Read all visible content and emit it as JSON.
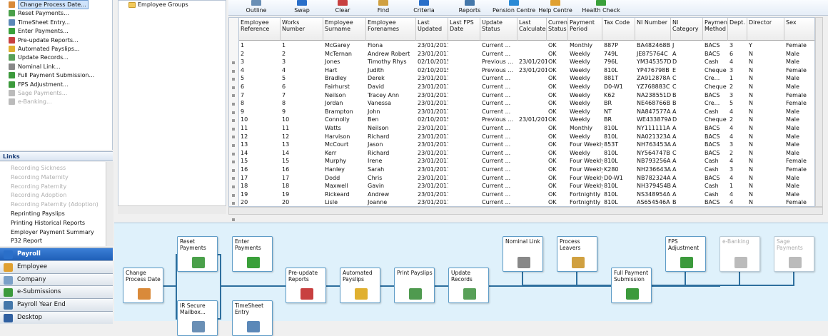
{
  "tasks": [
    {
      "label": "Change Process Date...",
      "selected": true,
      "disabled": false
    },
    {
      "label": "Reset Payments...",
      "disabled": false
    },
    {
      "label": "TimeSheet Entry...",
      "disabled": false
    },
    {
      "label": "Enter Payments...",
      "disabled": false
    },
    {
      "label": "Pre-update Reports...",
      "disabled": false
    },
    {
      "label": "Automated Payslips...",
      "disabled": false
    },
    {
      "label": "Update Records...",
      "disabled": false
    },
    {
      "label": "Nominal Link...",
      "disabled": false
    },
    {
      "label": "Full Payment Submission...",
      "disabled": false
    },
    {
      "label": "FPS Adjustment...",
      "disabled": false
    },
    {
      "label": "Sage Payments...",
      "disabled": true
    },
    {
      "label": "e-Banking...",
      "disabled": true
    }
  ],
  "links": {
    "title": "Links",
    "items": [
      {
        "label": "Recording Sickness",
        "disabled": true
      },
      {
        "label": "Recording Maternity",
        "disabled": true
      },
      {
        "label": "Recording Paternity",
        "disabled": true
      },
      {
        "label": "Recording Adoption",
        "disabled": true
      },
      {
        "label": "Recording Paternity (Adoption)",
        "disabled": true
      },
      {
        "label": "Reprinting Payslips",
        "disabled": false
      },
      {
        "label": "Printing Historical Reports",
        "disabled": false
      },
      {
        "label": "Employer Payment Summary",
        "disabled": false
      },
      {
        "label": "P32 Report",
        "disabled": false
      }
    ]
  },
  "nav": [
    {
      "label": "Payroll",
      "active": true,
      "icon": "payroll-icon",
      "color": "#2a6fc9"
    },
    {
      "label": "Employee",
      "icon": "employee-icon",
      "color": "#e0a030"
    },
    {
      "label": "Company",
      "icon": "company-icon",
      "color": "#7aa0c8"
    },
    {
      "label": "e-Submissions",
      "icon": "globe-icon",
      "color": "#3c9a3c"
    },
    {
      "label": "Payroll Year End",
      "icon": "pye-icon",
      "color": "#4477aa"
    },
    {
      "label": "Desktop",
      "icon": "desktop-icon",
      "color": "#3060a0"
    }
  ],
  "tree": {
    "item": "Employee Groups"
  },
  "toolbar": [
    {
      "label": "Outline",
      "icon": "outline-icon"
    },
    {
      "label": "Swap",
      "icon": "swap-icon"
    },
    {
      "label": "Clear",
      "icon": "clear-icon"
    },
    {
      "label": "Find",
      "icon": "find-icon"
    },
    {
      "label": "Criteria",
      "icon": "criteria-icon"
    },
    {
      "label": "Reports",
      "icon": "reports-icon"
    },
    {
      "label": "Pension Centre",
      "icon": "pension-icon"
    },
    {
      "label": "Help Centre",
      "icon": "help-icon"
    },
    {
      "label": "Health Check",
      "icon": "health-check-icon"
    }
  ],
  "grid": {
    "columns": [
      "Employee Reference",
      "Works Number",
      "Employee Surname",
      "Employee Forenames",
      "Last Updated",
      "Last FPS Date",
      "Update Status",
      "Last Calculated",
      "Current Status",
      "Payment Period",
      "Tax Code",
      "NI Number",
      "NI Category",
      "Payment Method",
      "Dept.",
      "Director",
      "Sex"
    ],
    "rows": [
      [
        "1",
        "1",
        "McGarey",
        "Fiona",
        "23/01/2017",
        "",
        "Current ...",
        "",
        "OK",
        "Monthly",
        "887P",
        "BA482468B",
        "J",
        "BACS",
        "3",
        "Y",
        "Female"
      ],
      [
        "2",
        "2",
        "McTernan",
        "Andrew Robert",
        "23/01/2017",
        "",
        "Current ...",
        "",
        "OK",
        "Weekly",
        "749L",
        "JE875764C",
        "A",
        "BACS",
        "6",
        "N",
        "Male"
      ],
      [
        "3",
        "3",
        "Jones",
        "Timothy Rhys",
        "02/10/2015",
        "",
        "Previous ...",
        "23/01/2017",
        "OK",
        "Weekly",
        "796L",
        "YM345357D",
        "D",
        "Cash",
        "4",
        "N",
        "Male"
      ],
      [
        "4",
        "4",
        "Hart",
        "Judith",
        "02/10/2015",
        "",
        "Previous ...",
        "23/01/2017",
        "OK",
        "Weekly",
        "810L",
        "YP476798B",
        "E",
        "Cheque",
        "3",
        "N",
        "Female"
      ],
      [
        "5",
        "5",
        "Bradley",
        "Derek",
        "23/01/2017",
        "",
        "Current ...",
        "",
        "OK",
        "Weekly",
        "881T",
        "ZA912878A",
        "C",
        "Cre...",
        "1",
        "N",
        "Male"
      ],
      [
        "6",
        "6",
        "Fairhurst",
        "David",
        "23/01/2017",
        "",
        "Current ...",
        "",
        "OK",
        "Weekly",
        "D0-W1",
        "YZ768883C",
        "C",
        "Cheque",
        "2",
        "N",
        "Male"
      ],
      [
        "7",
        "7",
        "Neilson",
        "Tracey Ann",
        "23/01/2017",
        "",
        "Current ...",
        "",
        "OK",
        "Weekly",
        "K62",
        "NA238551D",
        "B",
        "BACS",
        "3",
        "N",
        "Female"
      ],
      [
        "8",
        "8",
        "Jordan",
        "Vanessa",
        "23/01/2017",
        "",
        "Current ...",
        "",
        "OK",
        "Weekly",
        "BR",
        "NE468766B",
        "B",
        "Cre...",
        "5",
        "N",
        "Female"
      ],
      [
        "9",
        "9",
        "Brampton",
        "John",
        "23/01/2017",
        "",
        "Current ...",
        "",
        "OK",
        "Weekly",
        "NT",
        "NA847577A",
        "A",
        "Cash",
        "4",
        "N",
        "Male"
      ],
      [
        "10",
        "10",
        "Connolly",
        "Ben",
        "02/10/2015",
        "",
        "Previous ...",
        "23/01/2017",
        "OK",
        "Weekly",
        "BR",
        "WE433879A",
        "D",
        "Cheque",
        "2",
        "N",
        "Male"
      ],
      [
        "11",
        "11",
        "Watts",
        "Neilson",
        "23/01/2017",
        "",
        "Current ...",
        "",
        "OK",
        "Monthly",
        "810L",
        "NY111111A",
        "A",
        "BACS",
        "4",
        "N",
        "Male"
      ],
      [
        "12",
        "12",
        "Harvison",
        "Richard",
        "23/01/2017",
        "",
        "Current ...",
        "",
        "OK",
        "Weekly",
        "810L",
        "NA021323A",
        "A",
        "BACS",
        "4",
        "N",
        "Male"
      ],
      [
        "13",
        "13",
        "McCourt",
        "Jason",
        "23/01/2017",
        "",
        "Current ...",
        "",
        "OK",
        "Four Weekly",
        "853T",
        "NH763453A",
        "A",
        "BACS",
        "3",
        "N",
        "Male"
      ],
      [
        "14",
        "14",
        "Kerr",
        "Richard",
        "23/01/2017",
        "",
        "Current ...",
        "",
        "OK",
        "Weekly",
        "810L",
        "NY564747B",
        "C",
        "BACS",
        "2",
        "N",
        "Male"
      ],
      [
        "15",
        "15",
        "Murphy",
        "Irene",
        "23/01/2017",
        "",
        "Current ...",
        "",
        "OK",
        "Four Weekly",
        "810L",
        "NB793256A",
        "A",
        "Cash",
        "4",
        "N",
        "Female"
      ],
      [
        "16",
        "16",
        "Hanley",
        "Sarah",
        "23/01/2017",
        "",
        "Current ...",
        "",
        "OK",
        "Four Weekly",
        "K280",
        "NH236643A",
        "A",
        "Cash",
        "3",
        "N",
        "Female"
      ],
      [
        "17",
        "17",
        "Dodd",
        "Chris",
        "23/01/2017",
        "",
        "Current ...",
        "",
        "OK",
        "Four Weekly",
        "D0-W1",
        "NB782324A",
        "A",
        "BACS",
        "4",
        "N",
        "Male"
      ],
      [
        "18",
        "18",
        "Maxwell",
        "Gavin",
        "23/01/2017",
        "",
        "Current ...",
        "",
        "OK",
        "Four Weekly",
        "810L",
        "NH379454B",
        "A",
        "Cash",
        "1",
        "N",
        "Male"
      ],
      [
        "19",
        "19",
        "Rickeard",
        "Andrew",
        "23/01/2017",
        "",
        "Current ...",
        "",
        "OK",
        "Fortnightly",
        "810L",
        "NS348954A",
        "A",
        "Cash",
        "4",
        "N",
        "Male"
      ],
      [
        "20",
        "20",
        "Lisle",
        "Joanne",
        "23/01/2017",
        "",
        "Current ...",
        "",
        "OK",
        "Fortnightly",
        "810L",
        "AS654546A",
        "B",
        "BACS",
        "4",
        "N",
        "Female"
      ]
    ]
  },
  "flow": [
    {
      "label": "Change\nProcess Date",
      "icon": "calendar-icon",
      "color": "#d98a3a"
    },
    {
      "label": "Reset\nPayments",
      "icon": "reset-payments-icon",
      "color": "#4aa04a"
    },
    {
      "label": "IR Secure\nMailbox...",
      "icon": "mailbox-icon",
      "color": "#6a8fb5"
    },
    {
      "label": "Enter\nPayments",
      "icon": "enter-payments-icon",
      "color": "#3aa03a"
    },
    {
      "label": "TimeSheet\nEntry",
      "icon": "timesheet-icon",
      "color": "#5b88b8"
    },
    {
      "label": "Pre-update\nReports",
      "icon": "reports-chart-icon",
      "color": "#c84040"
    },
    {
      "label": "Automated\nPayslips",
      "icon": "payslips-icon",
      "color": "#e0b030"
    },
    {
      "label": "Print Payslips",
      "icon": "print-icon",
      "color": "#4f9a4f"
    },
    {
      "label": "Update\nRecords",
      "icon": "update-records-icon",
      "color": "#58a058"
    },
    {
      "label": "Nominal Link",
      "icon": "nominal-link-icon",
      "color": "#888888"
    },
    {
      "label": "Process\nLeavers",
      "icon": "leavers-icon",
      "color": "#d0a040"
    },
    {
      "label": "Full Payment\nSubmission",
      "icon": "globe-icon",
      "color": "#3c9a3c"
    },
    {
      "label": "FPS\nAdjustment",
      "icon": "globe-icon",
      "color": "#3c9a3c"
    },
    {
      "label": "e-Banking",
      "icon": "bank-icon",
      "color": "#bbbbbb",
      "disabled": true
    },
    {
      "label": "Sage\nPayments",
      "icon": "sage-payments-icon",
      "color": "#bbbbbb",
      "disabled": true
    }
  ]
}
